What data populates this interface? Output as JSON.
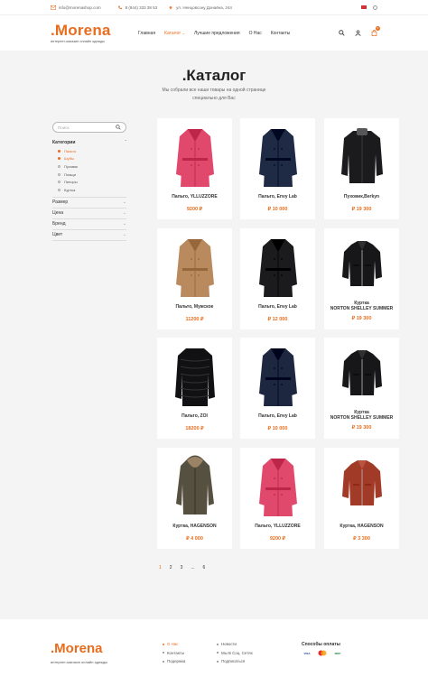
{
  "topbar": {
    "email": "info@morenashop.com",
    "phone": "8 (844) 333 38 53",
    "address": "ул. Ненцовсону Донаёна, 244"
  },
  "header": {
    "logo": ".Morena",
    "tagline": "интернет-магазин онлайн одежды",
    "nav": [
      {
        "label": "Главная"
      },
      {
        "label": "Каталог"
      },
      {
        "label": "Лучшие предложения"
      },
      {
        "label": "О Нас"
      },
      {
        "label": "Контакты"
      }
    ],
    "cart_count": "0"
  },
  "page": {
    "title": ".Каталог",
    "subtitle_line1": "Мы собрали все наши товары на одной странице",
    "subtitle_line2": "специально для Вас"
  },
  "sidebar": {
    "search_placeholder": "Поиск",
    "category_heading": "Категории",
    "categories": [
      "Пальто",
      "Шубы",
      "Пуховик",
      "Плащи",
      "Пиноры",
      "Куртка"
    ],
    "filters": [
      "Размер",
      "Цена",
      "Бренд",
      "Цвет"
    ]
  },
  "products": [
    {
      "name": "Пальто, YLLUZZORE",
      "price": "9200 ₽",
      "color": "#e0496b",
      "type": "coat"
    },
    {
      "name": "Пальто, Envy Lab",
      "price": "₽ 10 000",
      "color": "#1f2a44",
      "type": "coat"
    },
    {
      "name": "Пуховик,Berkyn",
      "price": "₽ 19 300",
      "color": "#1b1b1e",
      "type": "puffer"
    },
    {
      "name": "Пальто, Мужское",
      "price": "11200 ₽",
      "color": "#b98a5e",
      "type": "coat"
    },
    {
      "name": "Пальто, Envy Lab",
      "price": "₽ 12 000",
      "color": "#1b1b1d",
      "type": "coat"
    },
    {
      "name": "Куртка",
      "name2": "NORTON SHELLEY SUMMER",
      "price": "₽ 19 300",
      "color": "#17171a",
      "type": "jacket"
    },
    {
      "name": "Пальто, ZOI",
      "price": "18200 ₽",
      "color": "#111114",
      "type": "fur"
    },
    {
      "name": "Пальто, Envy Lab",
      "price": "₽ 10 000",
      "color": "#1e2740",
      "type": "coat"
    },
    {
      "name": "Куртка",
      "name2": "NORTON SHELLEY SUMMER",
      "price": "₽ 19 300",
      "color": "#17171a",
      "type": "jacket"
    },
    {
      "name": "Куртка, HAGENSON",
      "price": "₽ 4 000",
      "color": "#55503f",
      "type": "parka"
    },
    {
      "name": "Пальто, YLLUZZORE",
      "price": "9200 ₽",
      "color": "#e0496b",
      "type": "coat"
    },
    {
      "name": "Куртка, HAGENSON",
      "price": "₽ 3 300",
      "color": "#a13a27",
      "type": "jacket"
    }
  ],
  "pagination": {
    "pages": [
      "1",
      "2",
      "3",
      "...",
      "6"
    ],
    "current": "1"
  },
  "footer": {
    "logo": ".Morena",
    "tagline": "интернет-магазин онлайн одежды",
    "col1": [
      "О Нас",
      "Контакты",
      "Подержка"
    ],
    "col2": [
      "Новости",
      "Мы В Соц. Сетях",
      "Подписаться"
    ],
    "payments_title": "Способы оплаты",
    "payments": [
      "VISA",
      "MC",
      "МИР"
    ]
  }
}
